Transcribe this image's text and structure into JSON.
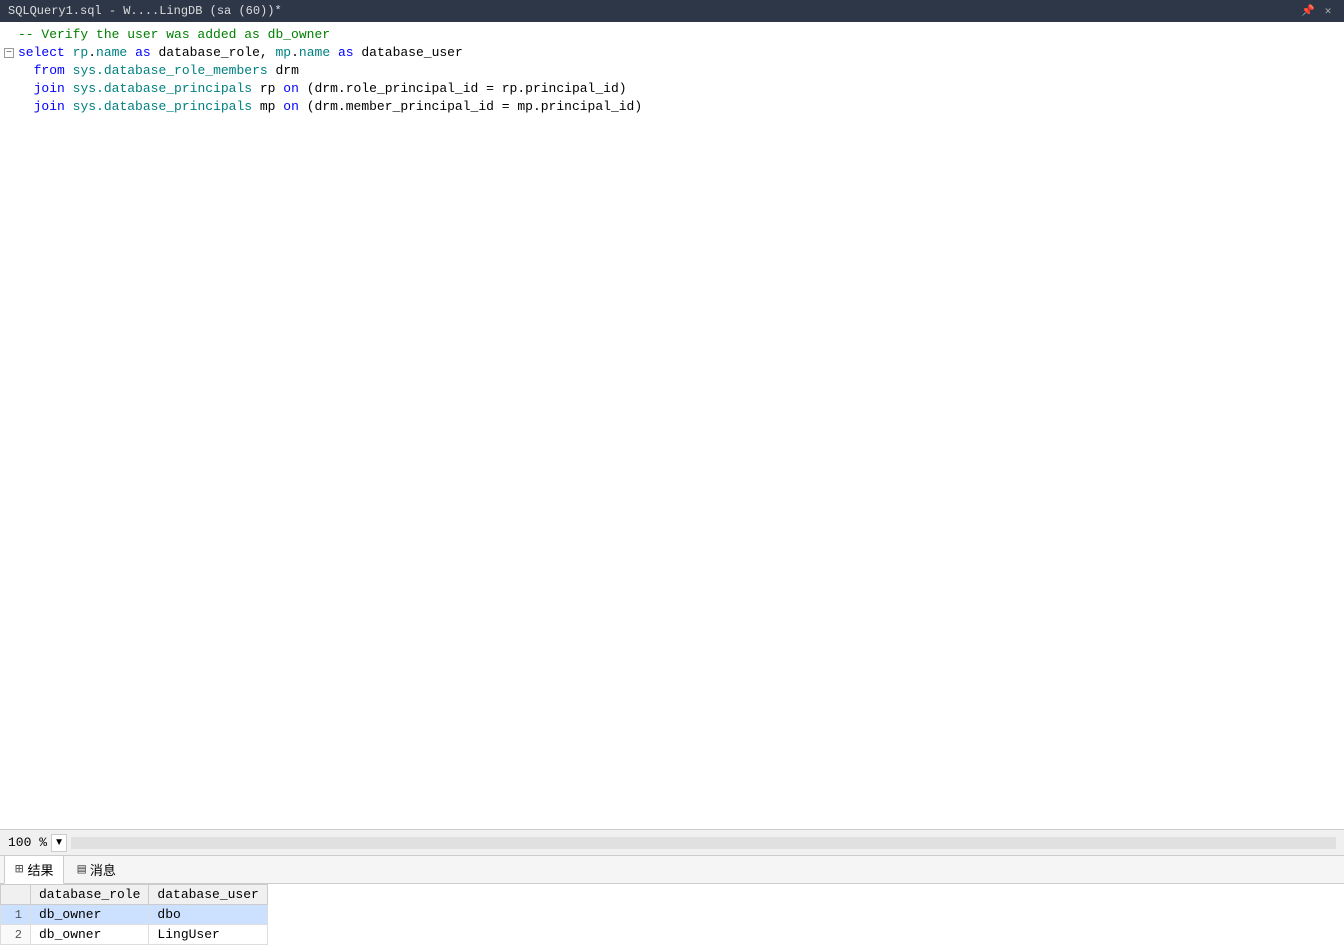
{
  "titleBar": {
    "text": "SQLQuery1.sql - W....LingDB (sa (60))*",
    "pinIcon": "📌",
    "closeIcon": "✕"
  },
  "editor": {
    "lines": [
      {
        "id": 1,
        "hasCollapse": false,
        "indicator": "",
        "tokens": [
          {
            "type": "comment",
            "text": "-- Verify the user was added as db_owner"
          }
        ]
      },
      {
        "id": 2,
        "hasCollapse": true,
        "indicator": "⊟",
        "tokens": [
          {
            "type": "keyword",
            "text": "select "
          },
          {
            "type": "object",
            "text": "rp"
          },
          {
            "type": "plain",
            "text": "."
          },
          {
            "type": "object",
            "text": "name"
          },
          {
            "type": "plain",
            "text": " "
          },
          {
            "type": "keyword",
            "text": "as"
          },
          {
            "type": "plain",
            "text": " database_role, "
          },
          {
            "type": "object",
            "text": "mp"
          },
          {
            "type": "plain",
            "text": "."
          },
          {
            "type": "object",
            "text": "name"
          },
          {
            "type": "plain",
            "text": " "
          },
          {
            "type": "keyword",
            "text": "as"
          },
          {
            "type": "plain",
            "text": " database_user"
          }
        ]
      },
      {
        "id": 3,
        "hasCollapse": false,
        "indicator": "",
        "tokens": [
          {
            "type": "plain",
            "text": "  "
          },
          {
            "type": "keyword",
            "text": "from"
          },
          {
            "type": "plain",
            "text": " "
          },
          {
            "type": "object",
            "text": "sys.database_role_members"
          },
          {
            "type": "plain",
            "text": " drm"
          }
        ]
      },
      {
        "id": 4,
        "hasCollapse": false,
        "indicator": "",
        "tokens": [
          {
            "type": "plain",
            "text": "  "
          },
          {
            "type": "keyword",
            "text": "join"
          },
          {
            "type": "plain",
            "text": " "
          },
          {
            "type": "object",
            "text": "sys.database_principals"
          },
          {
            "type": "plain",
            "text": " rp "
          },
          {
            "type": "keyword",
            "text": "on"
          },
          {
            "type": "plain",
            "text": " (drm.role_principal_id = rp.principal_id)"
          }
        ]
      },
      {
        "id": 5,
        "hasCollapse": false,
        "indicator": "",
        "tokens": [
          {
            "type": "plain",
            "text": "  "
          },
          {
            "type": "keyword",
            "text": "join"
          },
          {
            "type": "plain",
            "text": " "
          },
          {
            "type": "object",
            "text": "sys.database_principals"
          },
          {
            "type": "plain",
            "text": " mp "
          },
          {
            "type": "keyword",
            "text": "on"
          },
          {
            "type": "plain",
            "text": " (drm.member_principal_id = mp.principal_id)"
          }
        ]
      }
    ]
  },
  "statusBar": {
    "zoom": "100 %",
    "dropdownArrow": "▼"
  },
  "resultsTabs": [
    {
      "id": "results",
      "icon": "⊞",
      "label": "结果",
      "active": true
    },
    {
      "id": "messages",
      "icon": "▤",
      "label": "消息",
      "active": false
    }
  ],
  "resultsTable": {
    "columns": [
      "database_role",
      "database_user"
    ],
    "rows": [
      {
        "num": "1",
        "cells": [
          "db_owner",
          "dbo"
        ],
        "selected": true
      },
      {
        "num": "2",
        "cells": [
          "db_owner",
          "LingUser"
        ],
        "selected": false
      }
    ]
  }
}
